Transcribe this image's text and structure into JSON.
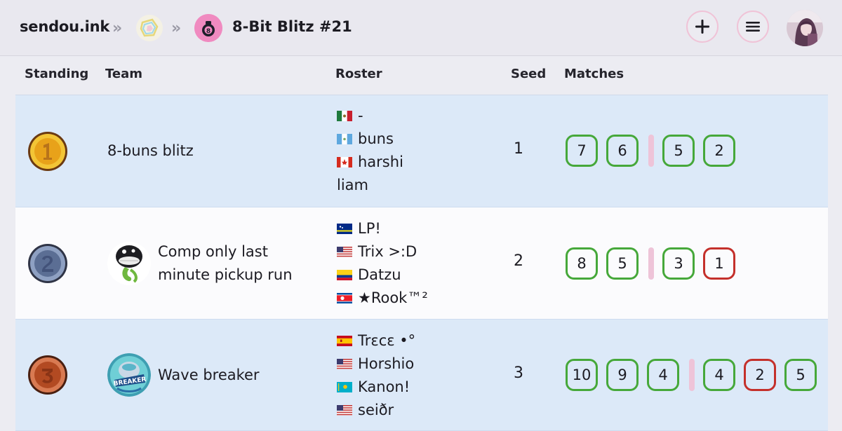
{
  "header": {
    "brand": "sendou.ink",
    "breadcrumb_sep": "»",
    "tournament_title": "8-Bit Blitz #21",
    "add_button_label": "+",
    "menu_button_label": "≡"
  },
  "table": {
    "columns": [
      "Standing",
      "Team",
      "Roster",
      "Seed",
      "Matches"
    ],
    "rows": [
      {
        "standing": 1,
        "team": "8-buns blitz",
        "has_logo": false,
        "roster": [
          {
            "flag": "mx",
            "name": "-"
          },
          {
            "flag": "gt",
            "name": "buns"
          },
          {
            "flag": "ca",
            "name": "harshi"
          },
          {
            "flag": "",
            "name": "liam"
          }
        ],
        "seed": "1",
        "matches_group1": [
          {
            "v": "7",
            "r": "win"
          },
          {
            "v": "6",
            "r": "win"
          }
        ],
        "matches_group2": [
          {
            "v": "5",
            "r": "win"
          },
          {
            "v": "2",
            "r": "win"
          }
        ]
      },
      {
        "standing": 2,
        "team_line1": "Comp only last",
        "team_line2": "minute pickup run",
        "has_logo": true,
        "roster": [
          {
            "flag": "cw",
            "name": "LP!"
          },
          {
            "flag": "us",
            "name": "Trix >:D"
          },
          {
            "flag": "co",
            "name": "Datzu"
          },
          {
            "flag": "kp",
            "name": "★Rook™²"
          }
        ],
        "seed": "2",
        "matches_group1": [
          {
            "v": "8",
            "r": "win"
          },
          {
            "v": "5",
            "r": "win"
          }
        ],
        "matches_group2": [
          {
            "v": "3",
            "r": "win"
          },
          {
            "v": "1",
            "r": "loss"
          }
        ]
      },
      {
        "standing": 3,
        "team": "Wave breaker",
        "has_logo": true,
        "logo_text": "BREAKER",
        "roster": [
          {
            "flag": "es",
            "name": "Trɛcɛ •°"
          },
          {
            "flag": "us",
            "name": "Horshio"
          },
          {
            "flag": "kz",
            "name": "Kanon!"
          },
          {
            "flag": "us",
            "name": "seiðr"
          }
        ],
        "seed": "3",
        "matches_group1": [
          {
            "v": "10",
            "r": "win"
          },
          {
            "v": "9",
            "r": "win"
          },
          {
            "v": "4",
            "r": "win"
          }
        ],
        "matches_group2": [
          {
            "v": "4",
            "r": "win"
          },
          {
            "v": "2",
            "r": "loss"
          },
          {
            "v": "5",
            "r": "win"
          }
        ]
      }
    ]
  },
  "colors": {
    "win": "#46a83a",
    "loss": "#c4302b",
    "gold": "#e8a21a",
    "silver": "#5b6e94",
    "bronze": "#b24a22"
  },
  "icons": [
    "chevron-double-right-icon",
    "plus-icon",
    "hamburger-menu-icon",
    "gold-medal-icon",
    "silver-medal-icon",
    "bronze-medal-icon"
  ]
}
